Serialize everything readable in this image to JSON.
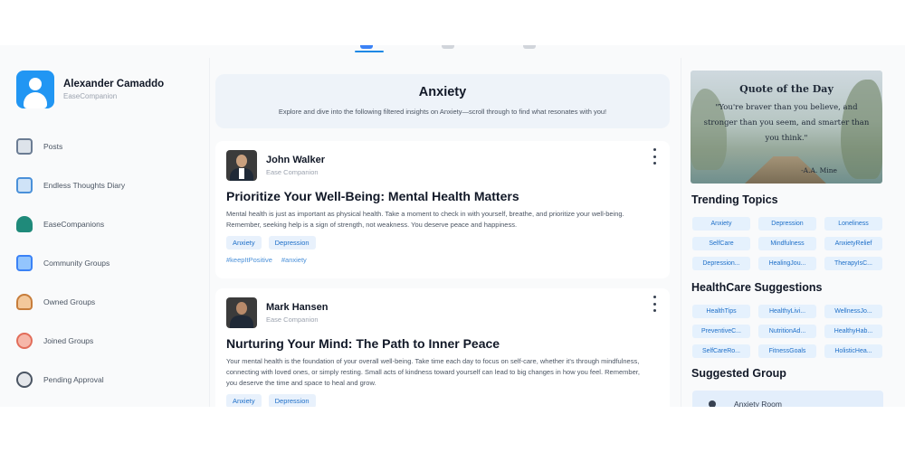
{
  "user": {
    "name": "Alexander Camaddo",
    "subtitle": "EaseCompanion"
  },
  "sidebar": {
    "items": [
      {
        "label": "Posts",
        "icon": "posts-icon",
        "color": "#6b7c93"
      },
      {
        "label": "Endless Thoughts Diary",
        "icon": "diary-icon",
        "color": "#4a90d9"
      },
      {
        "label": "EaseCompanions",
        "icon": "companions-icon",
        "color": "#1f8a7a"
      },
      {
        "label": "Community Groups",
        "icon": "community-icon",
        "color": "#3b82f6"
      },
      {
        "label": "Owned Groups",
        "icon": "owned-groups-icon",
        "color": "#c77d3b"
      },
      {
        "label": "Joined Groups",
        "icon": "joined-groups-icon",
        "color": "#e26d5a"
      },
      {
        "label": "Pending Approval",
        "icon": "pending-icon",
        "color": "#4b5563"
      }
    ]
  },
  "feed": {
    "topic_title": "Anxiety",
    "topic_description": "Explore and dive into the following filtered insights on Anxiety—scroll through to find what resonates with you!",
    "posts": [
      {
        "author": "John Walker",
        "company": "Ease Companion",
        "title": "Prioritize Your Well-Being: Mental Health Matters",
        "body": "Mental health is just as important as physical health. Take a moment to check in with yourself, breathe, and prioritize your well-being. Remember, seeking help is a sign of strength, not weakness. You deserve peace and happiness.",
        "tags": [
          "Anxiety",
          "Depression"
        ],
        "hashtags": [
          "#keepItPositive",
          "#anxiety"
        ]
      },
      {
        "author": "Mark Hansen",
        "company": "Ease Companion",
        "title": "Nurturing Your Mind: The Path to Inner Peace",
        "body": "Your mental health is the foundation of your overall well-being. Take time each day to focus on self-care, whether it's through mindfulness, connecting with loved ones, or simply resting. Small acts of kindness toward yourself can lead to big changes in how you feel. Remember, you deserve the time and space to heal and grow.",
        "tags": [
          "Anxiety",
          "Depression"
        ]
      }
    ]
  },
  "quote": {
    "heading": "Quote of the Day",
    "text": "\"You're braver than you believe, and stronger than you seem, and smarter than you think.\"",
    "author": "-A.A. Mine"
  },
  "trending": {
    "title": "Trending Topics",
    "topics": [
      "Anxiety",
      "Depression",
      "Loneliness",
      "SelfCare",
      "Mindfulness",
      "AnxietyRelief",
      "Depression...",
      "HealingJou...",
      "TherapyIsC..."
    ]
  },
  "healthcare": {
    "title": "HealthCare Suggestions",
    "items": [
      "HealthTips",
      "HealthyLivi...",
      "WellnessJo...",
      "PreventiveC...",
      "NutritionAd...",
      "HealthyHab...",
      "SelfCareRo...",
      "FitnessGoals",
      "HolisticHea..."
    ]
  },
  "suggested": {
    "title": "Suggested Group",
    "group_name": "Anxiety Room"
  },
  "colors": {
    "accent": "#1e88e5",
    "chip_bg": "#e5f1fd",
    "chip_text": "#1e6fc8"
  }
}
